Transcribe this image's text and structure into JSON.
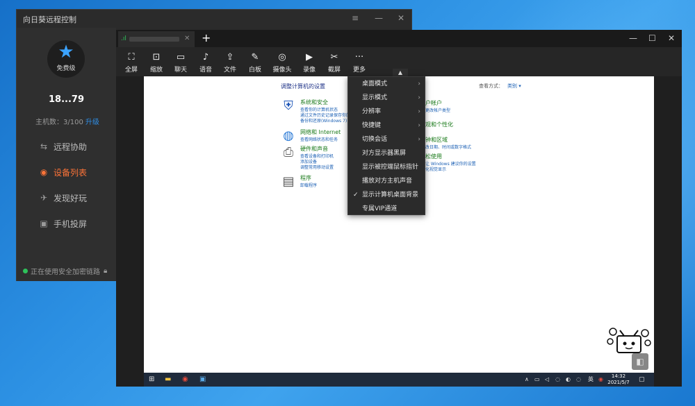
{
  "main_window": {
    "title": "向日葵远程控制",
    "profile": {
      "level": "免费级",
      "username": "18...79"
    },
    "hosts": {
      "count_label": "主机数：3/100",
      "upgrade": "升级"
    },
    "nav": [
      {
        "label": "远程协助",
        "icon": "remote-assist-icon"
      },
      {
        "label": "设备列表",
        "icon": "device-list-icon",
        "active": true
      },
      {
        "label": "发现好玩",
        "icon": "discover-icon"
      },
      {
        "label": "手机投屏",
        "icon": "screen-cast-icon"
      }
    ],
    "secure_status": "正在使用安全加密链路"
  },
  "remote_window": {
    "new_tab": "+",
    "toolbar": [
      {
        "label": "全屏",
        "icon": "fullscreen-icon"
      },
      {
        "label": "缩放",
        "icon": "scale-icon"
      },
      {
        "label": "聊天",
        "icon": "chat-icon"
      },
      {
        "label": "语音",
        "icon": "microphone-icon"
      },
      {
        "label": "文件",
        "icon": "file-transfer-icon"
      },
      {
        "label": "白板",
        "icon": "whiteboard-icon"
      },
      {
        "label": "摄像头",
        "icon": "camera-icon"
      },
      {
        "label": "录像",
        "icon": "video-record-icon"
      },
      {
        "label": "截屏",
        "icon": "screenshot-icon"
      },
      {
        "label": "更多",
        "icon": "more-icon"
      }
    ],
    "more_menu": [
      {
        "label": "桌面模式",
        "submenu": true
      },
      {
        "label": "显示模式",
        "submenu": true
      },
      {
        "label": "分辨率",
        "submenu": true
      },
      {
        "label": "快捷键",
        "submenu": true
      },
      {
        "label": "切换会话",
        "submenu": true
      },
      {
        "label": "对方显示器黑屏"
      },
      {
        "label": "显示被控端鼠标指针"
      },
      {
        "label": "播放对方主机声音"
      },
      {
        "label": "显示计算机桌面背景",
        "checked": true
      },
      {
        "label": "专属VIP通道"
      }
    ]
  },
  "control_panel": {
    "title": "调整计算机的设置",
    "view_by": "查看方式：",
    "view_by_value": "类别 ▾",
    "categories": [
      {
        "name": "系统和安全",
        "links": [
          "查看你的计算机状态",
          "通过文件历史记录保存你的文件备份副本",
          "备份和还原(Windows 7)"
        ]
      },
      {
        "name": "网络和 Internet",
        "links": [
          "查看网络状态和任务"
        ]
      },
      {
        "name": "硬件和声音",
        "links": [
          "查看设备和打印机",
          "添加设备",
          "调整常用移动设置"
        ]
      },
      {
        "name": "程序",
        "links": [
          "卸载程序"
        ]
      }
    ],
    "right_partial": [
      {
        "name": "户帐户",
        "links": [
          "更改帐户类型"
        ]
      },
      {
        "name": "观和个性化",
        "links": []
      },
      {
        "name": "钟和区域",
        "links": [
          "改日期、时间或数字格式"
        ]
      },
      {
        "name": "松使用",
        "links": [
          "让 Windows 建议你的设置",
          "化视觉显示"
        ]
      }
    ]
  },
  "remote_taskbar": {
    "ime": "英",
    "time": "14:32",
    "date": "2021/5/7"
  }
}
